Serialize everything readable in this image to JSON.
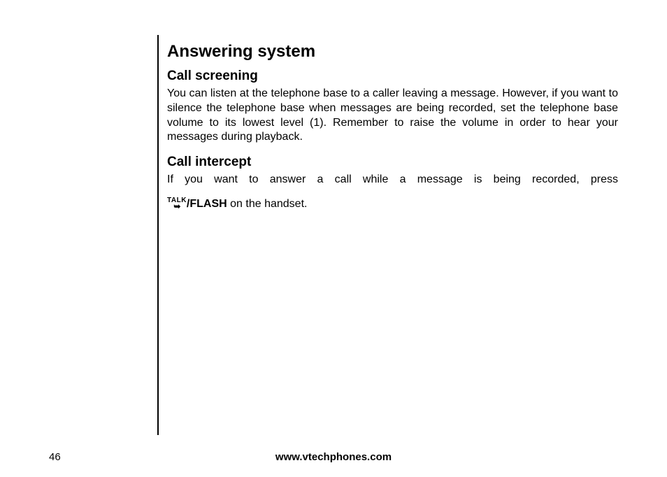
{
  "title": "Answering system",
  "sections": {
    "screening": {
      "heading": "Call screening",
      "body": "You can listen at the telephone base to a caller leaving a message. However, if you want to silence the telephone base when messages are being recorded, set the telephone base volume to its lowest level (1). Remember to raise the volume in order to hear your messages during playback."
    },
    "intercept": {
      "heading": "Call intercept",
      "line1": "If you want to answer a call while a message is being recorded, press",
      "icon_label": "TALK",
      "icon_glyph": "➥",
      "flash_label": "/FLASH",
      "line2_tail": " on the handset."
    }
  },
  "footer": {
    "page_number": "46",
    "url": "www.vtechphones.com"
  }
}
